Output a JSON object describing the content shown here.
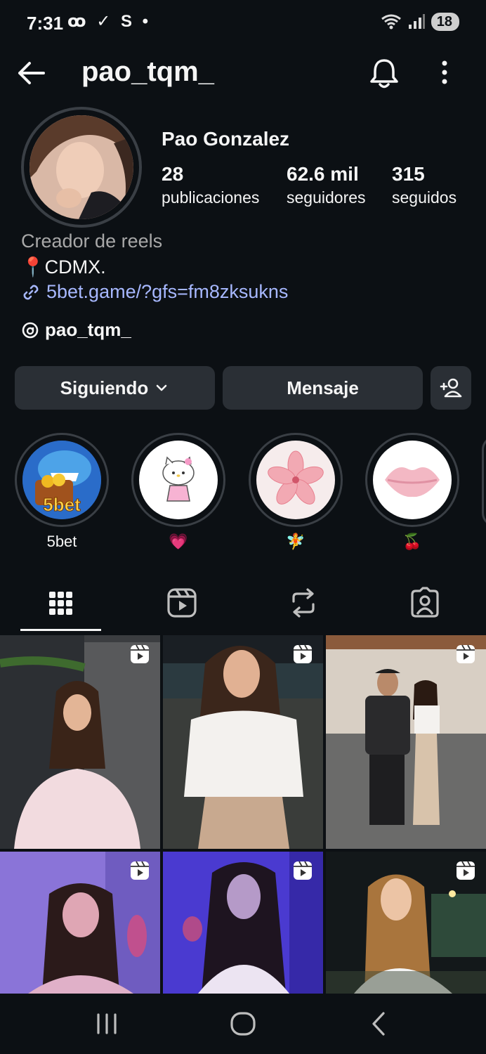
{
  "status": {
    "time": "7:31",
    "left_icons": "ꝏ ✓ S •",
    "battery": "18"
  },
  "header": {
    "username": "pao_tqm_",
    "back_icon": "arrow-left-icon",
    "bell_icon": "bell-icon",
    "more_icon": "more-vertical-icon"
  },
  "profile": {
    "display_name": "Pao Gonzalez",
    "stats": [
      {
        "value": "28",
        "label": "publicaciones"
      },
      {
        "value": "62.6 mil",
        "label": "seguidores"
      },
      {
        "value": "315",
        "label": "seguidos"
      }
    ],
    "category": "Creador de reels",
    "bio_emoji": "📍",
    "bio": "CDMX.",
    "link": "5bet.game/?gfs=fm8zksukns",
    "threads_handle": "pao_tqm_"
  },
  "buttons": {
    "following": "Siguiendo",
    "message": "Mensaje",
    "add_user_icon": "add-user-icon"
  },
  "highlights": [
    {
      "label": "5bet",
      "icon": "shark-treasure"
    },
    {
      "label": "💗",
      "icon": "hello-kitty"
    },
    {
      "label": "🧚",
      "icon": "flower"
    },
    {
      "label": "🍒",
      "icon": "lips"
    }
  ],
  "tabs": [
    "grid-icon",
    "reels-icon",
    "reposts-icon",
    "tagged-icon"
  ],
  "colors": {
    "background": "#0c1014",
    "button": "#2a2f35",
    "link": "#a7b8ff",
    "secondary_text": "#a8a8a8"
  }
}
